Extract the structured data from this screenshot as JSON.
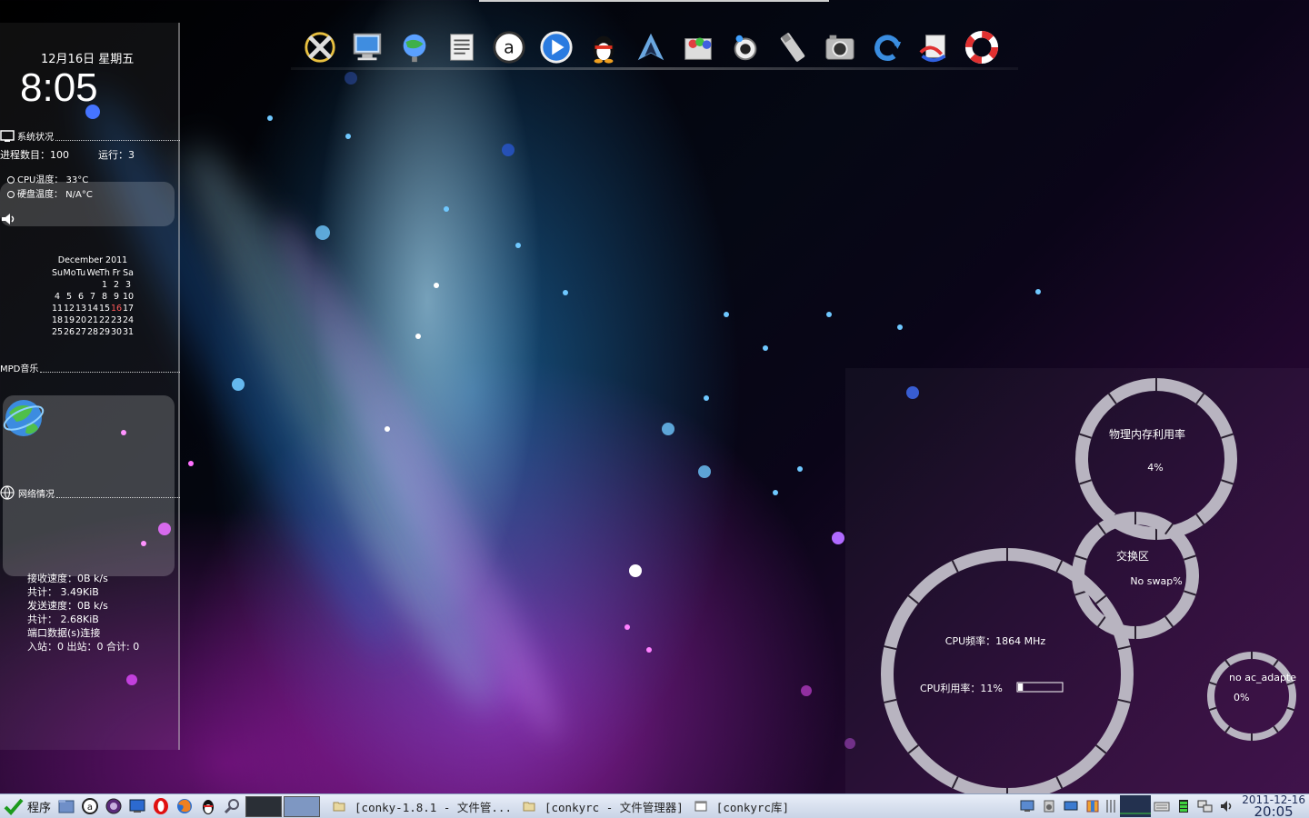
{
  "dock": {
    "icons": [
      "crossover-icon",
      "computer-icon",
      "globe-icon",
      "text-editor-icon",
      "amule-icon",
      "media-player-icon",
      "qq-penguin-icon",
      "arch-icon",
      "picture-tools-icon",
      "webcam-icon",
      "usb-drive-icon",
      "camera-icon",
      "refresh-icon",
      "pdf-convert-icon",
      "lifebuoy-icon"
    ]
  },
  "conky": {
    "date": "12月16日 星期五",
    "time": "8:05",
    "system_title": "系统状况",
    "processes": "进程数目：100",
    "running": "运行：3",
    "cpu_temp": "CPU温度：  33°C",
    "disk_temp": "硬盘温度：  N/A°C",
    "calendar": {
      "month": "December 2011",
      "weekdays": [
        "Su",
        "Mo",
        "Tu",
        "We",
        "Th",
        "Fr",
        "Sa"
      ],
      "weeks": [
        [
          "",
          "",
          "",
          "",
          "1",
          "2",
          "3"
        ],
        [
          "4",
          "5",
          "6",
          "7",
          "8",
          "9",
          "10"
        ],
        [
          "11",
          "12",
          "13",
          "14",
          "15",
          "16",
          "17"
        ],
        [
          "18",
          "19",
          "20",
          "21",
          "22",
          "23",
          "24"
        ],
        [
          "25",
          "26",
          "27",
          "28",
          "29",
          "30",
          "31"
        ]
      ],
      "today": "16"
    },
    "mpd_title": "MPD音乐",
    "network_title": "网络情况",
    "recv_speed": "接收速度：0B k/s",
    "recv_total": "共计：  3.49KiB",
    "send_speed": "发送速度：0B k/s",
    "send_total": "共计：  2.68KiB",
    "ports": "端口数据(s)连接",
    "port_counts": "入站：0  出站：0  合计: 0"
  },
  "rings": {
    "memory_label": "物理内存利用率",
    "memory_value": "4%",
    "swap_label": "交换区",
    "swap_value": "No swap%",
    "cpu_freq": "CPU频率：1864 MHz",
    "cpu_usage": "CPU利用率：11%",
    "cpu_usage_fraction": 0.11,
    "battery_label": "no ac_adapte",
    "battery_value": "0%"
  },
  "taskbar": {
    "start_label": "程序",
    "quicklaunch": [
      "file-manager-icon",
      "amule-icon",
      "mplayer-icon",
      "desktop-icon",
      "opera-icon",
      "firefox-icon",
      "qq-icon",
      "search-icon"
    ],
    "tasks": [
      {
        "label": "[conky-1.8.1 - 文件管..."
      },
      {
        "label": "[conkyrc - 文件管理器]"
      },
      {
        "label": "[conkyrc库]"
      }
    ],
    "clock_date": "2011-12-16",
    "clock_time": "20:05"
  }
}
